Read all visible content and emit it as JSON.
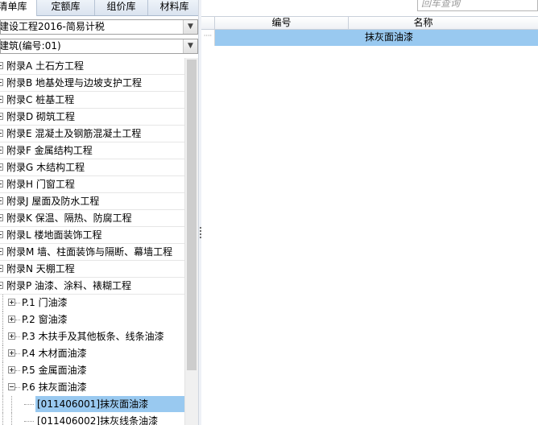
{
  "tabs": [
    {
      "label": "清单库",
      "active": true
    },
    {
      "label": "定额库",
      "active": false
    },
    {
      "label": "组价库",
      "active": false
    },
    {
      "label": "材料库",
      "active": false
    }
  ],
  "library_combo": {
    "value": "建设工程2016-简易计税"
  },
  "specialty_combo": {
    "value": "建筑(编号:01)"
  },
  "tree": {
    "appendices": [
      {
        "label": "附录A 土石方工程"
      },
      {
        "label": "附录B 地基处理与边坡支护工程"
      },
      {
        "label": "附录C 桩基工程"
      },
      {
        "label": "附录D 砌筑工程"
      },
      {
        "label": "附录E 混凝土及钢筋混凝土工程"
      },
      {
        "label": "附录F 金属结构工程"
      },
      {
        "label": "附录G 木结构工程"
      },
      {
        "label": "附录H 门窗工程"
      },
      {
        "label": "附录J 屋面及防水工程"
      },
      {
        "label": "附录K 保温、隔热、防腐工程"
      },
      {
        "label": "附录L 楼地面装饰工程"
      },
      {
        "label": "附录M 墙、柱面装饰与隔断、幕墙工程"
      },
      {
        "label": "附录N 天棚工程"
      },
      {
        "label": "附录P 油漆、涂料、裱糊工程"
      }
    ],
    "sections": [
      {
        "label": "P.1 门油漆",
        "expanded": false
      },
      {
        "label": "P.2 窗油漆",
        "expanded": false
      },
      {
        "label": "P.3 木扶手及其他板条、线条油漆",
        "expanded": false
      },
      {
        "label": "P.4 木材面油漆",
        "expanded": false
      },
      {
        "label": "P.5 金属面油漆",
        "expanded": false
      },
      {
        "label": "P.6 抹灰面油漆",
        "expanded": true
      }
    ],
    "items": [
      {
        "label": "[011406001]抹灰面油漆",
        "selected": true
      },
      {
        "label": "[011406002]抹灰线条油漆",
        "selected": false
      }
    ]
  },
  "search": {
    "placeholder": "回车查询"
  },
  "grid": {
    "headers": {
      "code": "编号",
      "name": "名称"
    },
    "rows": [
      {
        "code": "",
        "name": "抹灰面油漆"
      }
    ]
  },
  "colors": {
    "selection": "#99c9f0",
    "tab_bar": "#dde6f2"
  }
}
